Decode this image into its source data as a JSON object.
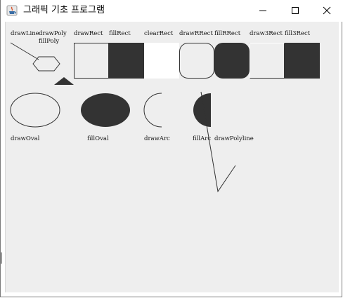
{
  "window": {
    "title": "그래픽 기초 프로그램",
    "app_icon": "java-cup-icon",
    "controls": {
      "minimize_icon": "minimize-icon",
      "maximize_icon": "maximize-icon",
      "close_icon": "close-icon"
    }
  },
  "canvas": {
    "labels": {
      "drawLine": "drawLine",
      "drawPoly": "drawPoly",
      "fillPoly": "fillPoly",
      "drawRect": "drawRect",
      "fillRect": "fillRect",
      "clearRect": "clearRect",
      "drawRRect": "drawRRect",
      "fillRRect": "fillRRect",
      "draw3Rect": "draw3Rect",
      "fill3Rect": "fill3Rect",
      "drawOval": "drawOval",
      "fillOval": "fillOval",
      "drawArc": "drawArc",
      "fillArc": "fillArc",
      "drawPolyline": "drawPolyline"
    },
    "colors": {
      "background": "#eeeeee",
      "stroke": "#333333",
      "fill": "#333333",
      "clear": "#ffffff"
    }
  }
}
